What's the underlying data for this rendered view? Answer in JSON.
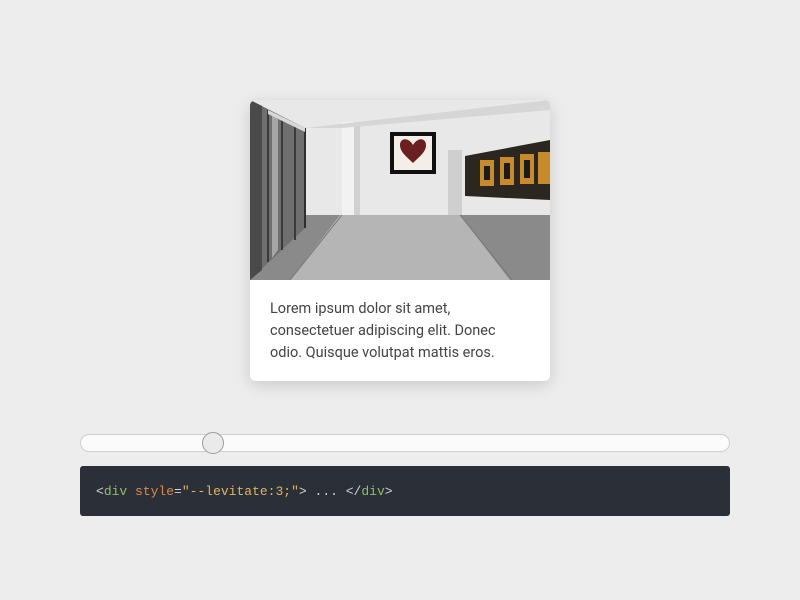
{
  "card": {
    "text": "Lorem ipsum dolor sit amet, consectetuer adipiscing elit. Donec odio. Quisque volutpat mattis eros."
  },
  "slider": {
    "min": 0,
    "max": 30,
    "value": 3
  },
  "code": {
    "angle_open": "<",
    "tag": "div",
    "space": " ",
    "attr": "style",
    "eq": "=",
    "quote": "\"",
    "str_content": "--levitate:3;",
    "angle_close": ">",
    "mid": " ... ",
    "slash": "/"
  }
}
